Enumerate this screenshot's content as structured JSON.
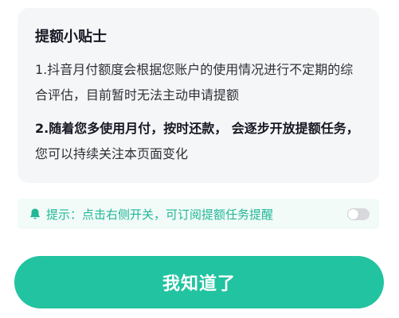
{
  "tips": {
    "title": "提额小贴士",
    "item1": "1.抖音月付额度会根据您账户的使用情况进行不定期的综合评估，目前暂时无法主动申请提额",
    "item2_bold": "2.随着您多使用月付，按时还款， 会逐步开放提额任务，",
    "item2_rest": "您可以持续关注本页面变化"
  },
  "notify": {
    "icon": "bell-icon",
    "text": "提示：点击右侧开关，可订阅提额任务提醒",
    "toggle_on": false
  },
  "confirm_button": {
    "label": "我知道了"
  },
  "colors": {
    "accent": "#22c3a0",
    "accent_text": "#22b797",
    "card_bg": "#f5f6f7",
    "notify_bg": "#f2fbf8"
  }
}
